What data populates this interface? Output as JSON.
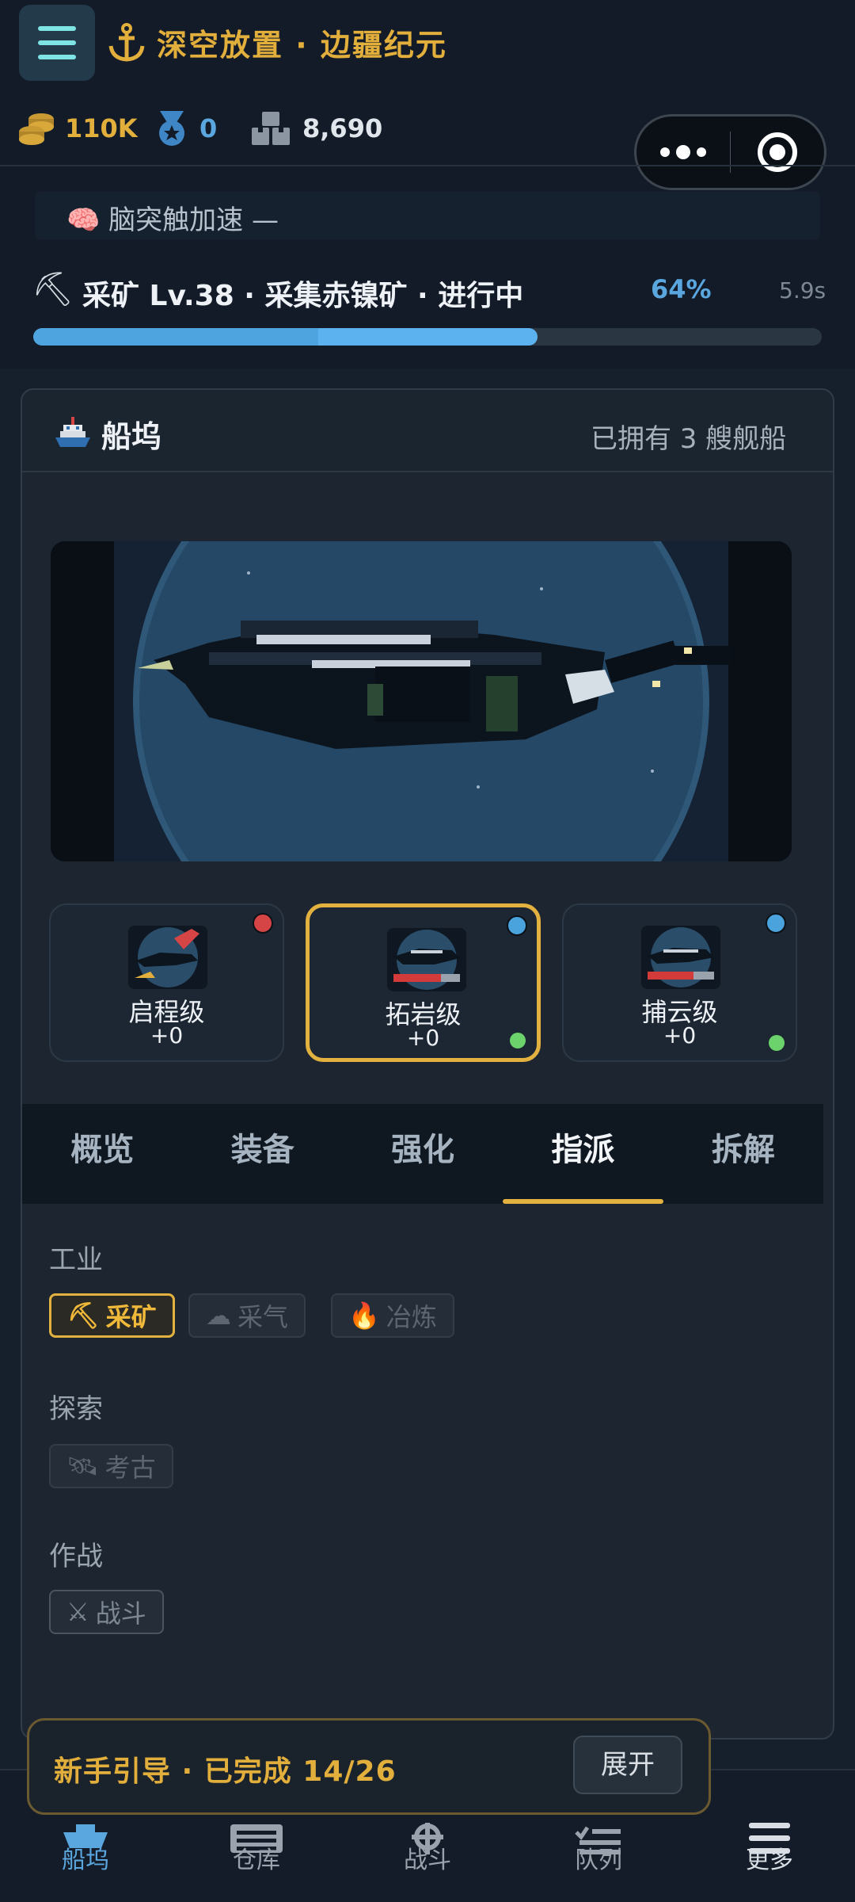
{
  "header": {
    "title": "深空放置 · 边疆纪元",
    "resources": [
      {
        "icon": "coin-stack-icon",
        "value": "110K"
      },
      {
        "icon": "medal-icon",
        "value": "0"
      },
      {
        "icon": "materials-icon",
        "value": "8,690"
      }
    ]
  },
  "boost": {
    "label": "🧠 脑突触加速 —"
  },
  "activity": {
    "text": "采矿 Lv.38 · 采集赤镍矿 · 进行中",
    "percent_label": "64%",
    "percent": 64,
    "time": "5.9s"
  },
  "dock": {
    "title": "船坞",
    "count_text": "已拥有 3 艘舰船",
    "ships": [
      {
        "name": "启程级",
        "level": "+0",
        "corner_color": "#d64545",
        "bottom_dot": false
      },
      {
        "name": "拓岩级",
        "level": "+0",
        "corner_color": "#4aa3dd",
        "bottom_dot": true,
        "selected": true
      },
      {
        "name": "捕云级",
        "level": "+0",
        "corner_color": "#4aa3dd",
        "bottom_dot": true
      }
    ]
  },
  "tabs": [
    "概览",
    "装备",
    "强化",
    "指派",
    "拆解"
  ],
  "active_tab": "指派",
  "assign": {
    "industry_label": "工业",
    "industry_chips": [
      {
        "icon": "pickaxe-icon",
        "glyph": "⛏",
        "label": "采矿",
        "active": true
      },
      {
        "icon": "cloud-icon",
        "glyph": "☁",
        "label": "采气",
        "active": false
      },
      {
        "icon": "fire-icon",
        "glyph": "🔥",
        "label": "冶炼",
        "active": false
      }
    ],
    "explore_label": "探索",
    "explore_chips": [
      {
        "icon": "satellite-icon",
        "glyph": "🛰",
        "label": "考古",
        "active": false
      }
    ],
    "combat_label": "作战",
    "combat_chips": [
      {
        "icon": "crossed-swords-icon",
        "glyph": "⚔",
        "label": "战斗",
        "active": false
      }
    ]
  },
  "guide": {
    "text": "新手引导 · 已完成 14/26",
    "button": "展开"
  },
  "nav": [
    {
      "label": "船坞",
      "icon": "ship-icon",
      "active": true
    },
    {
      "label": "仓库",
      "icon": "warehouse-icon",
      "active": false
    },
    {
      "label": "战斗",
      "icon": "helm-icon",
      "active": false
    },
    {
      "label": "队列",
      "icon": "queue-list-icon",
      "active": false
    },
    {
      "label": "更多",
      "icon": "menu-icon",
      "active": false
    }
  ],
  "colors": {
    "accent": "#e2ae3c",
    "blue": "#5aa7e0",
    "bg": "#16202c"
  }
}
